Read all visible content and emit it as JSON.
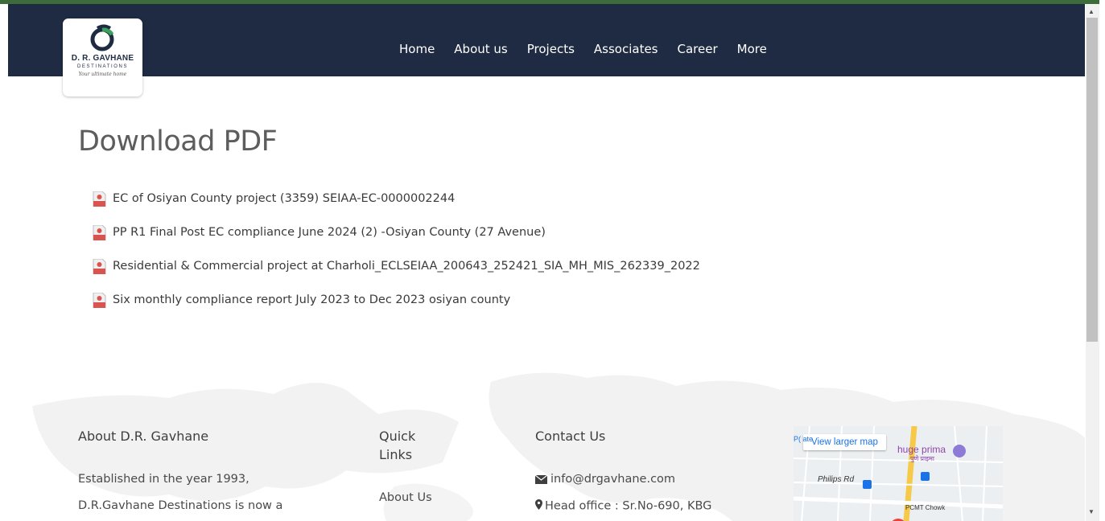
{
  "header": {
    "logo": {
      "brand": "D. R. GAVHANE",
      "sub": "DESTINATIONS",
      "tagline": "Your ultimate home"
    },
    "nav": [
      "Home",
      "About us",
      "Projects",
      "Associates",
      "Career",
      "More"
    ]
  },
  "main": {
    "title": "Download PDF",
    "pdfs": [
      "EC of Osiyan County project (3359) SEIAA-EC-0000002244",
      "PP R1 Final Post EC compliance June 2024 (2) -Osiyan County (27 Avenue)",
      "Residential & Commercial project at Charholi_ECLSEIAA_200643_252421_SIA_MH_MIS_262339_2022",
      "Six monthly compliance report July 2023 to Dec 2023 osiyan county"
    ],
    "pdf_icon_label": "PDF"
  },
  "footer": {
    "about": {
      "title": "About D.R. Gavhane",
      "line1": "Established in the year 1993,",
      "line2": "D.R.Gavhane Destinations is now a"
    },
    "quick_links": {
      "title_line1": "Quick",
      "title_line2": "Links",
      "items": [
        "About Us"
      ]
    },
    "contact": {
      "title": "Contact Us",
      "email": "info@drgavhane.com",
      "address": "Head office : Sr.No-690, KBG"
    },
    "map": {
      "button": "View larger map",
      "labels": {
        "place1": "huge prima",
        "place1_local": "पुणे प्राइमा",
        "road": "Philips Rd",
        "chowk": "PCMT Chowk",
        "edge": "P( ate"
      }
    }
  },
  "colors": {
    "header_bg": "#1f2b43",
    "accent_green": "#3d6b3a",
    "pdf_red": "#d9534f"
  }
}
